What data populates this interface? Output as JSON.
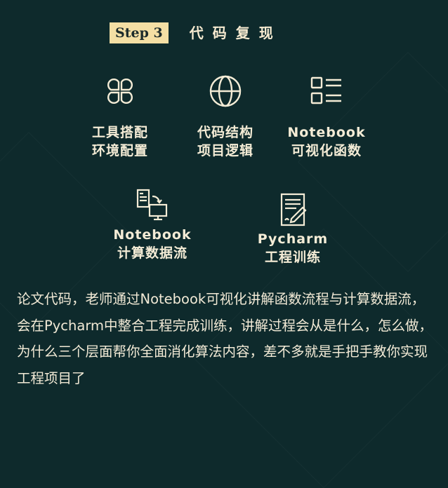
{
  "header": {
    "step_label": "Step 3",
    "title": "代码复现"
  },
  "features": [
    {
      "icon": "clover-icon",
      "line1": "工具搭配",
      "line2": "环境配置"
    },
    {
      "icon": "globe-icon",
      "line1": "代码结构",
      "line2": "项目逻辑"
    },
    {
      "icon": "list-icon",
      "line1": "Notebook",
      "line2": "可视化函数"
    },
    {
      "icon": "computer-sync-icon",
      "line1": "Notebook",
      "line2": "计算数据流"
    },
    {
      "icon": "document-edit-icon",
      "line1": "Pycharm",
      "line2": "工程训练"
    }
  ],
  "description": "论文代码，老师通过Notebook可视化讲解函数流程与计算数据流，会在Pycharm中整合工程完成训练，讲解过程会从是什么，怎么做，为什么三个层面帮你全面消化算法内容，差不多就是手把手教你实现工程项目了",
  "colors": {
    "background": "#0e2a2c",
    "badge": "#f4dfa4",
    "text": "#f4ecd6"
  }
}
